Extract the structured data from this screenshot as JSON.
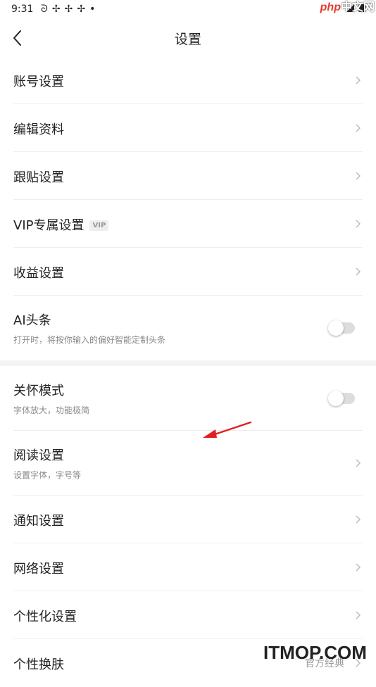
{
  "status_bar": {
    "time": "9:31",
    "icons": [
      "social-icon",
      "pinwheel-icon",
      "pinwheel-icon",
      "pinwheel-icon",
      "dot-icon"
    ]
  },
  "watermark_top": {
    "php": "php",
    "zh": "中文网"
  },
  "nav": {
    "title": "设置",
    "back_icon": "chevron-left-icon"
  },
  "rows": [
    {
      "label": "账号设置"
    },
    {
      "label": "编辑资料"
    },
    {
      "label": "跟贴设置"
    },
    {
      "label": "VIP专属设置",
      "badge": "VIP"
    },
    {
      "label": "收益设置"
    },
    {
      "label": "AI头条",
      "subtitle": "打开时，将按你输入的偏好智能定制头条",
      "toggle": false
    },
    {
      "label": "关怀模式",
      "subtitle": "字体放大，功能极简",
      "toggle": false
    },
    {
      "label": "阅读设置",
      "subtitle": "设置字体，字号等"
    },
    {
      "label": "通知设置"
    },
    {
      "label": "网络设置"
    },
    {
      "label": "个性化设置"
    },
    {
      "label": "个性换肤",
      "value": "官方经典"
    }
  ],
  "annotation": {
    "color": "#e02020"
  },
  "watermark_bottom": "ITMOP.COM"
}
